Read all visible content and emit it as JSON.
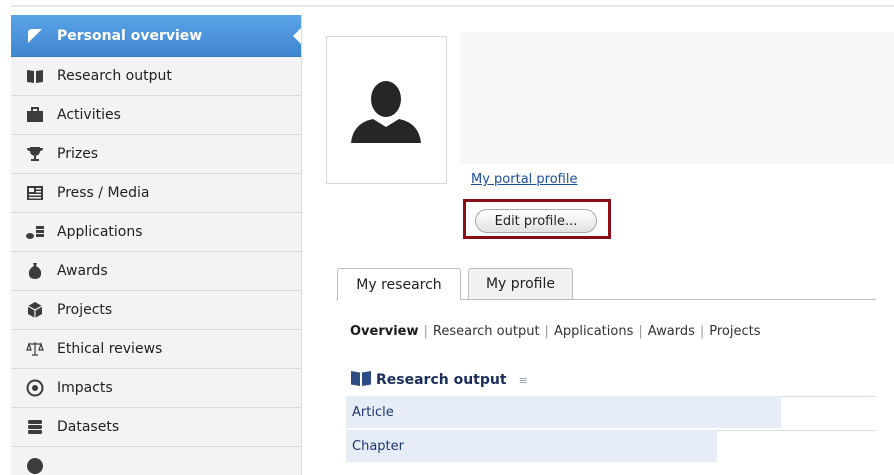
{
  "sidebar": {
    "items": [
      {
        "label": "Personal overview",
        "icon": "overview-icon",
        "active": true
      },
      {
        "label": "Research output",
        "icon": "book-icon"
      },
      {
        "label": "Activities",
        "icon": "briefcase-icon"
      },
      {
        "label": "Prizes",
        "icon": "trophy-icon"
      },
      {
        "label": "Press / Media",
        "icon": "newspaper-icon"
      },
      {
        "label": "Applications",
        "icon": "coins-icon"
      },
      {
        "label": "Awards",
        "icon": "money-bag-icon"
      },
      {
        "label": "Projects",
        "icon": "cube-icon"
      },
      {
        "label": "Ethical reviews",
        "icon": "scales-icon"
      },
      {
        "label": "Impacts",
        "icon": "target-icon"
      },
      {
        "label": "Datasets",
        "icon": "database-icon"
      }
    ]
  },
  "profile": {
    "portal_link": "My portal profile",
    "edit_button": "Edit profile..."
  },
  "tabs": [
    {
      "label": "My research",
      "active": true
    },
    {
      "label": "My profile",
      "active": false
    }
  ],
  "subnav": {
    "current": "Overview",
    "links": [
      "Research output",
      "Applications",
      "Awards",
      "Projects"
    ]
  },
  "research_output": {
    "title": "Research output",
    "menu_icon": "≡",
    "rows": [
      {
        "label": "Article",
        "share": 0.82
      },
      {
        "label": "Chapter",
        "share": 0.7
      }
    ]
  },
  "colors": {
    "active_blue": "#4a92dc",
    "highlight": "#8b0d16",
    "link": "#1d4e9a"
  }
}
